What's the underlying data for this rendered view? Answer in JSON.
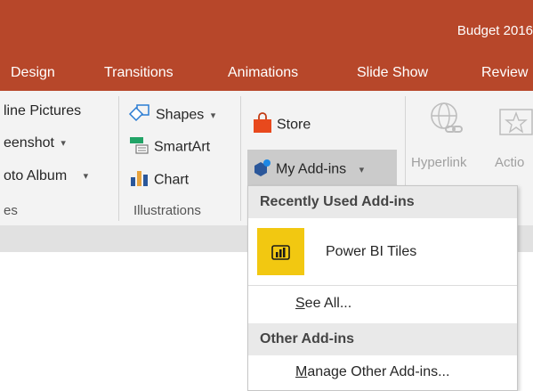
{
  "window": {
    "title": "Budget 2016"
  },
  "tabs": [
    {
      "label": "Design"
    },
    {
      "label": "Transitions"
    },
    {
      "label": "Animations"
    },
    {
      "label": "Slide Show"
    },
    {
      "label": "Review"
    }
  ],
  "ribbon": {
    "images_group": {
      "online_pictures": "line Pictures",
      "screenshot": "eenshot",
      "photo_album": "oto Album",
      "label": "es"
    },
    "illustrations_group": {
      "shapes": "Shapes",
      "smartart": "SmartArt",
      "chart": "Chart",
      "label": "Illustrations"
    },
    "addins_group": {
      "store": "Store",
      "my_addins": "My Add-ins"
    },
    "links_group": {
      "hyperlink": "Hyperlink",
      "action": "Actio"
    }
  },
  "dropdown": {
    "recent_header": "Recently Used Add-ins",
    "recent_items": [
      {
        "label": "Power BI Tiles"
      }
    ],
    "see_all_prefix": "S",
    "see_all_rest": "ee All...",
    "other_header": "Other Add-ins",
    "manage_prefix": "M",
    "manage_rest": "anage Other Add-ins..."
  },
  "colors": {
    "accent": "#b7472a",
    "ribbon_bg": "#f3f3f3",
    "powerbi_yellow": "#f2c811",
    "store_orange": "#e8491d",
    "addins_blue": "#2b579a"
  }
}
